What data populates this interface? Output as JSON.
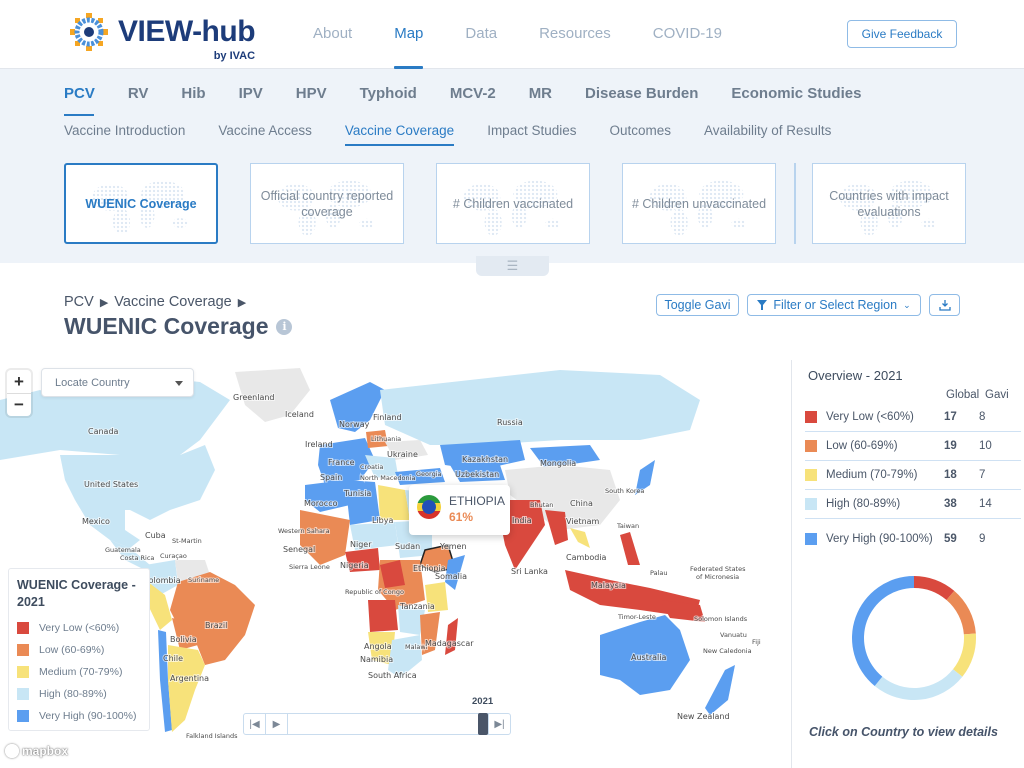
{
  "header": {
    "logo_title": "VIEW-hub",
    "logo_sub": "by IVAC",
    "nav": [
      {
        "label": "About",
        "active": false
      },
      {
        "label": "Map",
        "active": true
      },
      {
        "label": "Data",
        "active": false
      },
      {
        "label": "Resources",
        "active": false
      },
      {
        "label": "COVID-19",
        "active": false
      }
    ],
    "feedback_label": "Give Feedback"
  },
  "vaccine_tabs": [
    {
      "label": "PCV",
      "active": true
    },
    {
      "label": "RV"
    },
    {
      "label": "Hib"
    },
    {
      "label": "IPV"
    },
    {
      "label": "HPV"
    },
    {
      "label": "Typhoid"
    },
    {
      "label": "MCV-2"
    },
    {
      "label": "MR"
    },
    {
      "label": "Disease Burden"
    },
    {
      "label": "Economic Studies"
    }
  ],
  "section_tabs": [
    {
      "label": "Vaccine Introduction"
    },
    {
      "label": "Vaccine Access"
    },
    {
      "label": "Vaccine Coverage",
      "active": true
    },
    {
      "label": "Impact Studies"
    },
    {
      "label": "Outcomes"
    },
    {
      "label": "Availability of Results"
    }
  ],
  "cards": [
    {
      "label": "WUENIC Coverage",
      "active": true
    },
    {
      "label": "Official country reported coverage"
    },
    {
      "label": "# Children vaccinated"
    },
    {
      "label": "# Children unvaccinated"
    },
    {
      "label": "Countries with impact evaluations"
    }
  ],
  "breadcrumb": [
    "PCV",
    "Vaccine Coverage"
  ],
  "page_title": "WUENIC Coverage",
  "toolbar": {
    "toggle_gavi": "Toggle Gavi",
    "filter": "Filter or Select Region",
    "download_icon": "download-icon",
    "filter_icon": "filter-icon"
  },
  "map": {
    "locate_placeholder": "Locate Country",
    "zoom_in": "+",
    "zoom_out": "−",
    "tooltip": {
      "country": "ETHIOPIA",
      "value": "61%"
    },
    "legend": {
      "title": "WUENIC Coverage - 2021",
      "items": [
        "Very Low (<60%)",
        "Low (60-69%)",
        "Medium (70-79%)",
        "High (80-89%)",
        "Very High (90-100%)"
      ]
    },
    "attribution": "mapbox",
    "timeline_year": "2021",
    "colors": {
      "very_low": "#d9493e",
      "low": "#ea8a55",
      "medium": "#f7e27a",
      "high": "#c8e6f5",
      "very_high": "#5b9ef0",
      "no_data": "#e8e8e8"
    },
    "labels": [
      "Greenland",
      "Iceland",
      "Canada",
      "United States",
      "Mexico",
      "Cuba",
      "St-Martin",
      "Guatemala",
      "Costa Rica",
      "Curaçao",
      "Colombia",
      "Suriname",
      "Brazil",
      "Bolivia",
      "Chile",
      "Argentina",
      "Falkland Islands",
      "Finland",
      "Norway",
      "Russia",
      "Ireland",
      "Lithuania",
      "Ukraine",
      "France",
      "Croatia",
      "Spain",
      "North Macedonia",
      "Georgia",
      "Kazakhstan",
      "Uzbekistan",
      "Mongolia",
      "Tunisia",
      "Morocco",
      "Libya",
      "Western Sahara",
      "Senegal",
      "Niger",
      "Sudan",
      "Yemen",
      "Sierra Leone",
      "Nigeria",
      "Ethiopia",
      "Somalia",
      "Republic of Congo",
      "Tanzania",
      "Angola",
      "Malawi",
      "Madagascar",
      "Namibia",
      "South Africa",
      "China",
      "South Korea",
      "Taiwan",
      "India",
      "Bhutan",
      "Vietnam",
      "Cambodia",
      "Sri Lanka",
      "Malaysia",
      "Palau",
      "Federated States of Micronesia",
      "Timor-Leste",
      "Solomon Islands",
      "Vanuatu",
      "Fiji",
      "New Caledonia",
      "Australia",
      "New Zealand"
    ]
  },
  "overview": {
    "title": "Overview - 2021",
    "col_global": "Global",
    "col_gavi": "Gavi",
    "rows": [
      {
        "label": "Very Low (<60%)",
        "global": "17",
        "gavi": "8",
        "color": "#d9493e"
      },
      {
        "label": "Low (60-69%)",
        "global": "19",
        "gavi": "10",
        "color": "#ea8a55"
      },
      {
        "label": "Medium (70-79%)",
        "global": "18",
        "gavi": "7",
        "color": "#f7e27a"
      },
      {
        "label": "High (80-89%)",
        "global": "38",
        "gavi": "14",
        "color": "#c8e6f5"
      },
      {
        "label": "Very High (90-100%)",
        "global": "59",
        "gavi": "9",
        "color": "#5b9ef0"
      }
    ],
    "hint": "Click on Country to view details"
  }
}
